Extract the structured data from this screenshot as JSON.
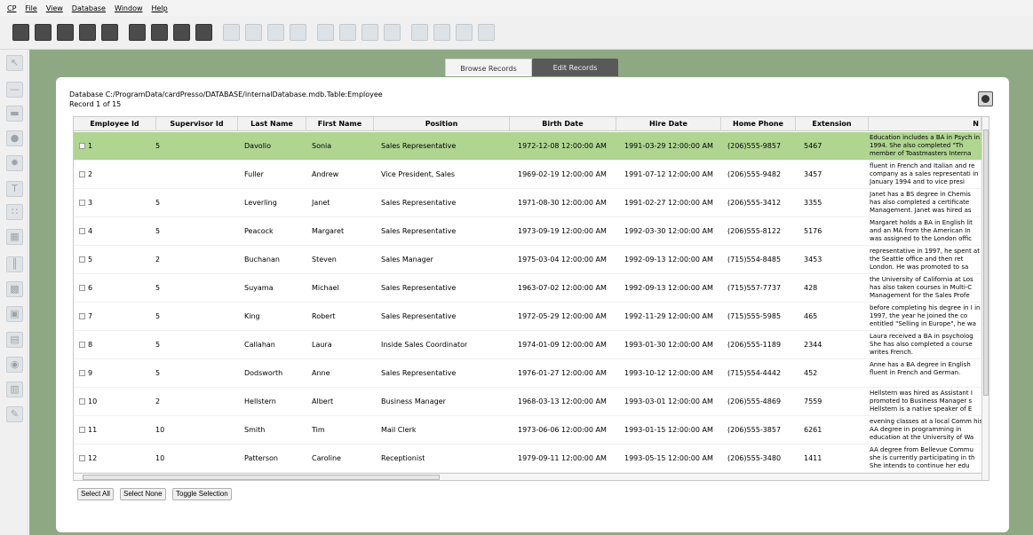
{
  "menubar": {
    "items": [
      "CP",
      "File",
      "View",
      "Database",
      "Window",
      "Help"
    ]
  },
  "tabs": {
    "browse": "Browse Records",
    "edit": "Edit Records"
  },
  "database": {
    "path": "Database C:/ProgramData/cardPresso/DATABASE/internalDatabase.mdb.Table:Employee",
    "record": "Record 1 of 15"
  },
  "table": {
    "headers": [
      "Employee Id",
      "Supervisor Id",
      "Last Name",
      "First Name",
      "Position",
      "Birth Date",
      "Hire Date",
      "Home Phone",
      "Extension",
      "N"
    ],
    "rows": [
      {
        "id": "1",
        "sup": "5",
        "last": "Davolio",
        "first": "Sonia",
        "pos": "Sales Representative",
        "birth": "1972-12-08 12:00:00 AM",
        "hire": "1991-03-29 12:00:00 AM",
        "phone": "(206)555-9857",
        "ext": "5467",
        "notes": "Education includes a BA in Psych in 1994. She also completed \"Th member of Toastmasters Interna"
      },
      {
        "id": "2",
        "sup": "",
        "last": "Fuller",
        "first": "Andrew",
        "pos": "Vice President, Sales",
        "birth": "1969-02-19 12:00:00 AM",
        "hire": "1991-07-12 12:00:00 AM",
        "phone": "(206)555-9482",
        "ext": "3457",
        "notes": "fluent in French and Italian and re company as a sales representati in January 1994 and to vice presi"
      },
      {
        "id": "3",
        "sup": "5",
        "last": "Leverling",
        "first": "Janet",
        "pos": "Sales Representative",
        "birth": "1971-08-30 12:00:00 AM",
        "hire": "1991-02-27 12:00:00 AM",
        "phone": "(206)555-3412",
        "ext": "3355",
        "notes": "Janet has a BS degree in Chemis has also completed a certificate Management. Janet was hired as"
      },
      {
        "id": "4",
        "sup": "5",
        "last": "Peacock",
        "first": "Margaret",
        "pos": "Sales Representative",
        "birth": "1973-09-19 12:00:00 AM",
        "hire": "1992-03-30 12:00:00 AM",
        "phone": "(206)555-8122",
        "ext": "5176",
        "notes": "Margaret holds a BA in English lit and an MA from the American In was assigned to the London offic"
      },
      {
        "id": "5",
        "sup": "2",
        "last": "Buchanan",
        "first": "Steven",
        "pos": "Sales Manager",
        "birth": "1975-03-04 12:00:00 AM",
        "hire": "1992-09-13 12:00:00 AM",
        "phone": "(715)554-8485",
        "ext": "3453",
        "notes": "representative in 1997, he spent at the Seattle office and then ret London. He was promoted to sa"
      },
      {
        "id": "6",
        "sup": "5",
        "last": "Suyama",
        "first": "Michael",
        "pos": "Sales Representative",
        "birth": "1963-07-02 12:00:00 AM",
        "hire": "1992-09-13 12:00:00 AM",
        "phone": "(715)557-7737",
        "ext": "428",
        "notes": "the University of California at Los has also taken courses in Multi-C Management for the Sales Profe"
      },
      {
        "id": "7",
        "sup": "5",
        "last": "King",
        "first": "Robert",
        "pos": "Sales Representative",
        "birth": "1972-05-29 12:00:00 AM",
        "hire": "1992-11-29 12:00:00 AM",
        "phone": "(715)555-5985",
        "ext": "465",
        "notes": "before completing his degree in I in 1997, the year he joined the co entitled \"Selling in Europe\", he wa"
      },
      {
        "id": "8",
        "sup": "5",
        "last": "Callahan",
        "first": "Laura",
        "pos": "Inside Sales Coordinator",
        "birth": "1974-01-09 12:00:00 AM",
        "hire": "1993-01-30 12:00:00 AM",
        "phone": "(206)555-1189",
        "ext": "2344",
        "notes": "Laura received a BA in psycholog She has also completed a course writes French."
      },
      {
        "id": "9",
        "sup": "5",
        "last": "Dodsworth",
        "first": "Anne",
        "pos": "Sales Representative",
        "birth": "1976-01-27 12:00:00 AM",
        "hire": "1993-10-12 12:00:00 AM",
        "phone": "(715)554-4442",
        "ext": "452",
        "notes": "Anne has a BA degree in English fluent in French and German."
      },
      {
        "id": "10",
        "sup": "2",
        "last": "Hellstern",
        "first": "Albert",
        "pos": "Business Manager",
        "birth": "1968-03-13 12:00:00 AM",
        "hire": "1993-03-01 12:00:00 AM",
        "phone": "(206)555-4869",
        "ext": "7559",
        "notes": "Hellstern was hired as Assistant I promoted to Business Manager s Hellstern is a native speaker of E"
      },
      {
        "id": "11",
        "sup": "10",
        "last": "Smith",
        "first": "Tim",
        "pos": "Mail Clerk",
        "birth": "1973-06-06 12:00:00 AM",
        "hire": "1993-01-15 12:00:00 AM",
        "phone": "(206)555-3857",
        "ext": "6261",
        "notes": "evening classes at a local Comm his AA degree in programming in education at the University of Wa"
      },
      {
        "id": "12",
        "sup": "10",
        "last": "Patterson",
        "first": "Caroline",
        "pos": "Receptionist",
        "birth": "1979-09-11 12:00:00 AM",
        "hire": "1993-05-15 12:00:00 AM",
        "phone": "(206)555-3480",
        "ext": "1411",
        "notes": "AA degree from Bellevue Commu she is currently participating in th She intends to continue her edu"
      }
    ]
  },
  "buttons": {
    "select_all": "Select All",
    "select_none": "Select None",
    "toggle_selection": "Toggle Selection"
  },
  "colors": {
    "workspace": "#8fa884",
    "selected_row": "#afd590",
    "active_tab": "#595959"
  }
}
